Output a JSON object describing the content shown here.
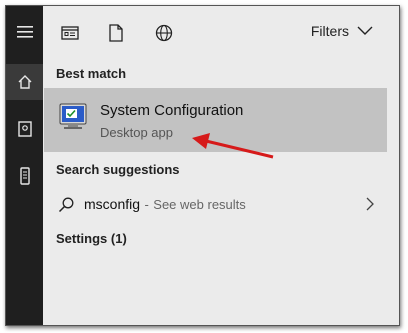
{
  "toolbar": {
    "filters_label": "Filters",
    "icons": [
      "apps-icon",
      "document-icon",
      "web-icon"
    ]
  },
  "sidebar": {
    "items": [
      "menu-icon",
      "home-icon",
      "notebook-icon",
      "device-icon"
    ]
  },
  "results": {
    "best_match_header": "Best match",
    "best_match": {
      "title": "System Configuration",
      "subtitle": "Desktop app"
    },
    "suggestions_header": "Search suggestions",
    "suggestion": {
      "query": "msconfig",
      "separator": "-",
      "action": "See web results"
    },
    "settings_header": "Settings (1)"
  },
  "colors": {
    "rail": "#1f1f1f",
    "panel": "#ebebeb",
    "selected": "#c2c2c2",
    "arrow": "#d61a1a"
  }
}
